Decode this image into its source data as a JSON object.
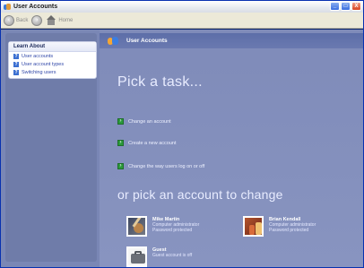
{
  "window": {
    "title": "User Accounts",
    "buttons": {
      "minimize": "_",
      "maximize": "□",
      "close": "X"
    }
  },
  "toolbar": {
    "back_label": "Back",
    "forward_glyph": "›",
    "back_glyph": "‹",
    "home_label": "Home"
  },
  "sidebar": {
    "heading": "Learn About",
    "help_glyph": "?",
    "items": [
      {
        "label": "User accounts"
      },
      {
        "label": "User account types"
      },
      {
        "label": "Switching users"
      }
    ]
  },
  "main": {
    "header_title": "User Accounts",
    "pick_task": "Pick a task...",
    "task_glyph": "›",
    "tasks": [
      {
        "label": "Change an account"
      },
      {
        "label": "Create a new account"
      },
      {
        "label": "Change the way users log on or off"
      }
    ],
    "pick_account": "or pick an account to change",
    "accounts": [
      {
        "name": "Mike Martin",
        "line1": "Computer administrator",
        "line2": "Password protected",
        "picture": "guitar-picture"
      },
      {
        "name": "Brian Kendall",
        "line1": "Computer administrator",
        "line2": "Password protected",
        "picture": "chess-picture"
      },
      {
        "name": "Guest",
        "line1": "Guest account is off",
        "line2": "",
        "picture": "briefcase-picture"
      }
    ]
  }
}
